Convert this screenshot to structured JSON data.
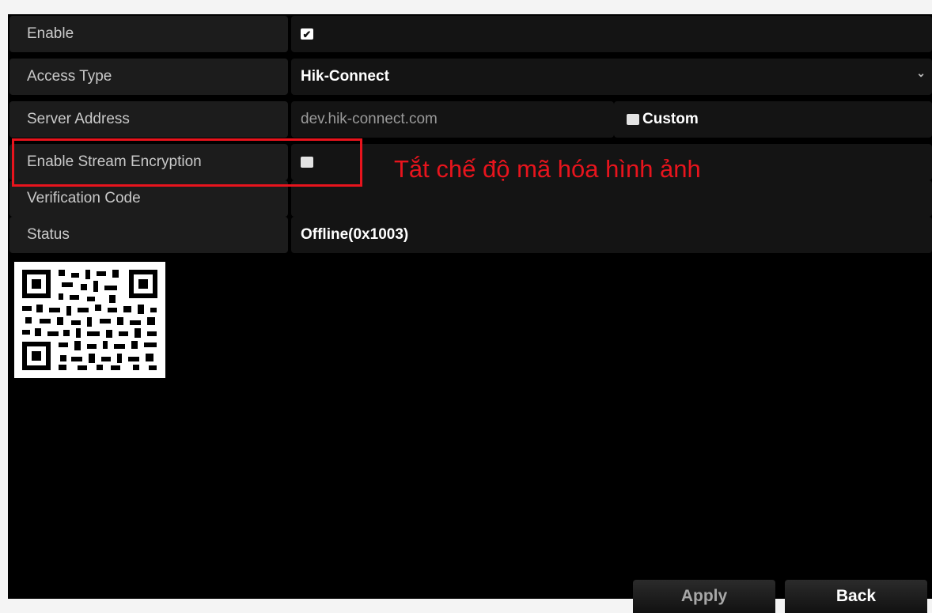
{
  "rows": {
    "enable": {
      "label": "Enable"
    },
    "access_type": {
      "label": "Access Type",
      "value": "Hik-Connect"
    },
    "server_address": {
      "label": "Server Address",
      "value": "dev.hik-connect.com",
      "custom_label": "Custom"
    },
    "stream_encryption": {
      "label": "Enable Stream Encryption"
    },
    "verification_code": {
      "label": "Verification Code",
      "value": ""
    },
    "status": {
      "label": "Status",
      "value": "Offline(0x1003)"
    }
  },
  "checkboxes": {
    "enable": true,
    "custom": false,
    "stream_encryption": false
  },
  "annotation": {
    "text": "Tắt chế độ mã hóa hình ảnh",
    "color": "#e8141d"
  },
  "buttons": {
    "apply": "Apply",
    "back": "Back"
  }
}
